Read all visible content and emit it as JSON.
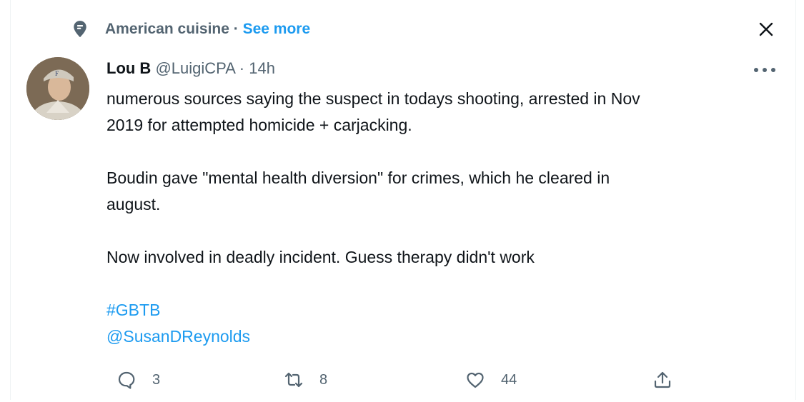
{
  "context": {
    "topic": "American cuisine",
    "separator": " · ",
    "see_more": "See more",
    "icon": "location-pin-icon"
  },
  "close_icon": "close-icon",
  "tweet": {
    "author_name": "Lou B",
    "handle": "@LuigiCPA",
    "time": "14h",
    "time_separator": " · ",
    "more_icon": "ellipsis-icon",
    "line1": "numerous sources saying the suspect in todays shooting, arrested in Nov",
    "line2": "2019 for attempted homicide + carjacking.",
    "line3": "Boudin gave \"mental health diversion\" for crimes, which he cleared in",
    "line4": "august.",
    "line5": "Now involved in deadly incident.  Guess therapy didn't work",
    "hashtag": "#GBTB",
    "mention": "@SusanDReynolds"
  },
  "actions": {
    "reply_count": "3",
    "retweet_count": "8",
    "like_count": "44"
  },
  "colors": {
    "accent": "#1d9bf0",
    "secondary_text": "#536471",
    "primary_text": "#0f1419"
  }
}
